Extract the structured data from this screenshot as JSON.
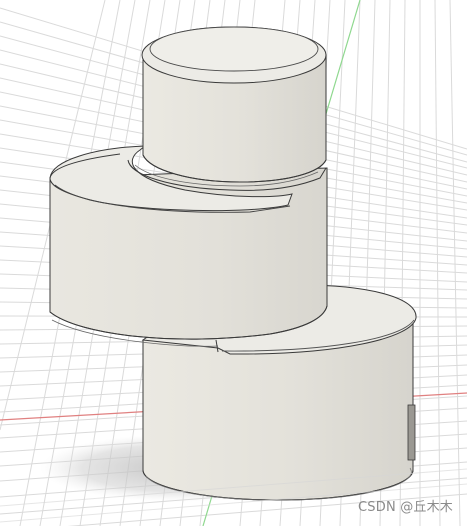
{
  "scene": {
    "background_color": "#ffffff",
    "grid_color": "#d9d9d9",
    "axis_x_color": "#e07a7a",
    "axis_y_color": "#7ed27e",
    "model_face_color": "#e6e4dd",
    "model_top_color": "#ecebe6",
    "model_edge_color": "#3a3a3a",
    "shadow_color": "#c8c8c8"
  },
  "model": {
    "name": "stacked-cylinder-part",
    "parts": [
      "top-cylinder",
      "middle-disc",
      "bottom-cylinder"
    ]
  },
  "watermark": {
    "text": "CSDN @丘木木"
  }
}
